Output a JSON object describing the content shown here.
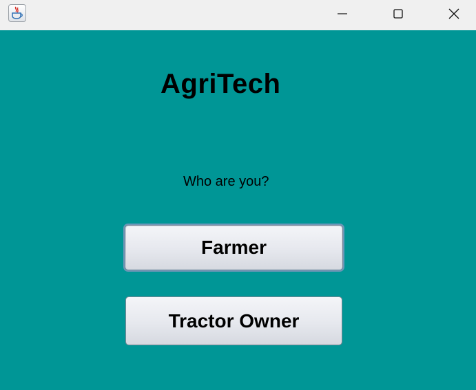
{
  "window": {
    "title": "",
    "icons": {
      "app": "java-coffee-cup-icon",
      "minimize": "minimize-icon",
      "maximize": "maximize-icon",
      "close": "close-icon"
    }
  },
  "colors": {
    "background": "#009696",
    "titlebar": "#f0f0f0"
  },
  "main": {
    "app_name": "AgriTech",
    "question": "Who are you?",
    "buttons": {
      "farmer": "Farmer",
      "tractor_owner": "Tractor Owner"
    }
  }
}
